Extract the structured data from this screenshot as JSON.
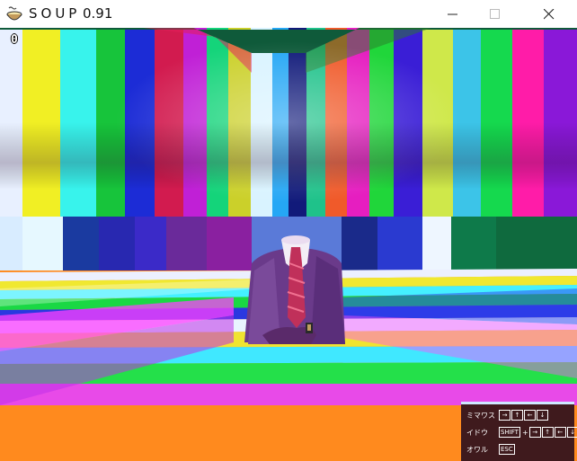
{
  "window": {
    "title": "SOUP",
    "version": "0.91",
    "icon": "soup-bowl-icon",
    "buttons": [
      "minimize-icon",
      "maximize-icon",
      "close-icon"
    ]
  },
  "hud": {
    "score": "0"
  },
  "controls": {
    "rows": [
      {
        "label": "ミマワス",
        "keys": [
          "→",
          "↑",
          "←",
          "↓"
        ]
      },
      {
        "label": "イドウ",
        "modifier": "SHIFT",
        "plus": "+",
        "keys": [
          "→",
          "↑",
          "←",
          "↓"
        ]
      },
      {
        "label": "オワル",
        "keys": [
          "ESC"
        ]
      }
    ]
  },
  "colors": {
    "panel": "#3f1a1d",
    "panel_border": "#cfe8ff"
  }
}
